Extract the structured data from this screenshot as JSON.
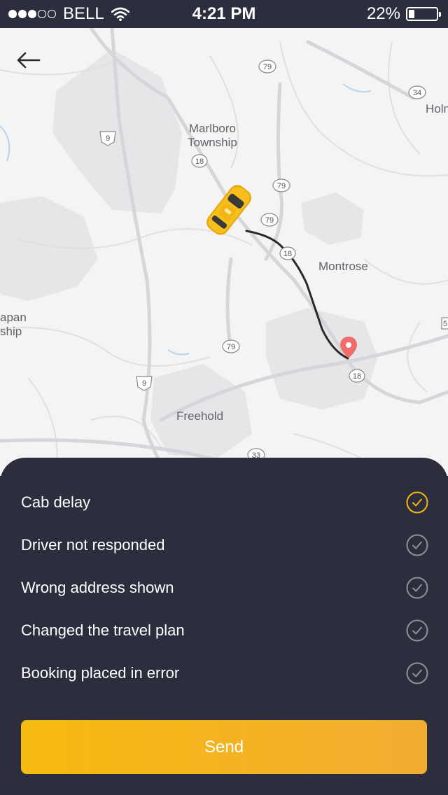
{
  "status_bar": {
    "carrier": "BELL",
    "time": "4:21 PM",
    "battery": "22%",
    "battery_level": 0.22,
    "signal_bars_filled": 3,
    "signal_bars_total": 5
  },
  "map": {
    "places": [
      {
        "name": "Marlboro\nTownship"
      },
      {
        "name": "Montrose"
      },
      {
        "name": "Freehold"
      },
      {
        "name": "Holn"
      },
      {
        "name": "apan\nship"
      }
    ],
    "route_markers": [
      "79",
      "79",
      "79",
      "79",
      "34",
      "9",
      "9",
      "18",
      "18",
      "18",
      "33",
      "5"
    ],
    "vehicle_icon": "taxi-car-icon",
    "destination_icon": "map-pin-icon"
  },
  "reasons": [
    {
      "label": "Cab delay",
      "selected": true
    },
    {
      "label": "Driver not responded",
      "selected": false
    },
    {
      "label": "Wrong address shown",
      "selected": false
    },
    {
      "label": "Changed the travel plan",
      "selected": false
    },
    {
      "label": "Booking placed in error",
      "selected": false
    }
  ],
  "send_label": "Send",
  "colors": {
    "sheet_bg": "#2c2e3e",
    "accent": "#f6bb0f",
    "check_selected": "#f5b90f",
    "check_unselected": "#8e909b",
    "route": "#2a2a2a",
    "pin": "#f26b6b"
  }
}
